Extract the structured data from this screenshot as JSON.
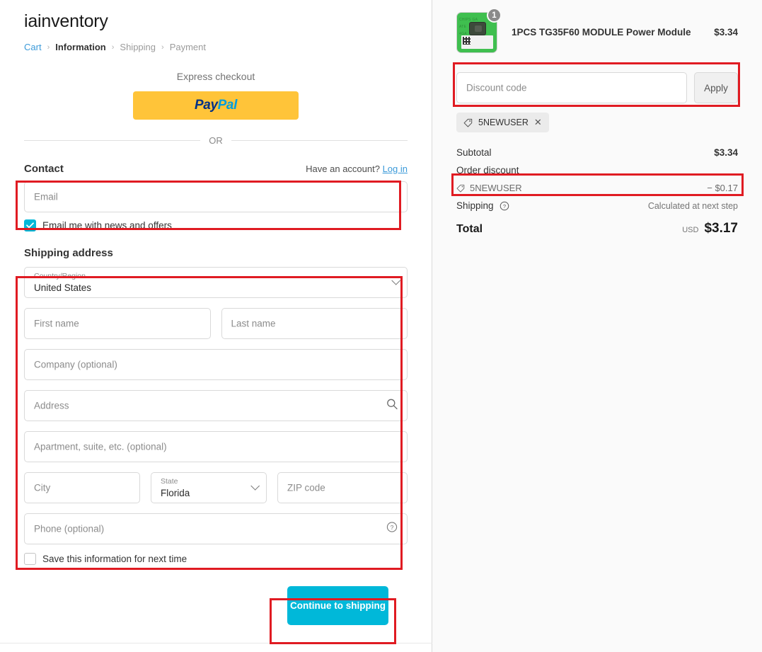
{
  "shop": {
    "name": "iainventory"
  },
  "breadcrumb": {
    "cart": "Cart",
    "sep": "›",
    "information": "Information",
    "shipping": "Shipping",
    "payment": "Payment"
  },
  "express": {
    "label": "Express checkout",
    "paypal_pay": "Pay",
    "paypal_pal": "Pal",
    "or": "OR"
  },
  "contact": {
    "title": "Contact",
    "account_note": "Have an account?",
    "login_link": "Log in",
    "email_placeholder": "Email",
    "email_value": "",
    "newsletter_label": "Email me with news and offers",
    "newsletter_checked": true
  },
  "shipping_address": {
    "title": "Shipping address",
    "country_label": "Country/Region",
    "country_value": "United States",
    "first_name_placeholder": "First name",
    "last_name_placeholder": "Last name",
    "company_placeholder": "Company (optional)",
    "address_placeholder": "Address",
    "apartment_placeholder": "Apartment, suite, etc. (optional)",
    "city_placeholder": "City",
    "state_label": "State",
    "state_value": "Florida",
    "zip_placeholder": "ZIP code",
    "phone_placeholder": "Phone (optional)",
    "save_info_label": "Save this information for next time",
    "save_info_checked": false
  },
  "actions": {
    "continue_label": "Continue to shipping"
  },
  "order_summary": {
    "product": {
      "name": "1PCS TG35F60 MODULE Power Module",
      "price": "$3.34",
      "quantity": "1",
      "pcb_text_1": "CHIPS GA",
      "pcb_text_2": "ATE",
      "pcb_text_3": "4GA"
    },
    "discount": {
      "placeholder": "Discount code",
      "value": "",
      "apply_label": "Apply",
      "chip_code": "5NEWUSER",
      "chip_remove": "✕"
    },
    "totals": {
      "subtotal_label": "Subtotal",
      "subtotal_value": "$3.34",
      "order_discount_label": "Order discount",
      "discount_code": "5NEWUSER",
      "discount_amount": "− $0.17",
      "shipping_label": "Shipping",
      "shipping_value": "Calculated at next step",
      "total_label": "Total",
      "currency": "USD",
      "total_value": "$3.17"
    }
  },
  "colors": {
    "accent": "#00b8d9",
    "link": "#3b9ad9",
    "paypal_bg": "#ffc439",
    "annotation": "#e01b22"
  }
}
